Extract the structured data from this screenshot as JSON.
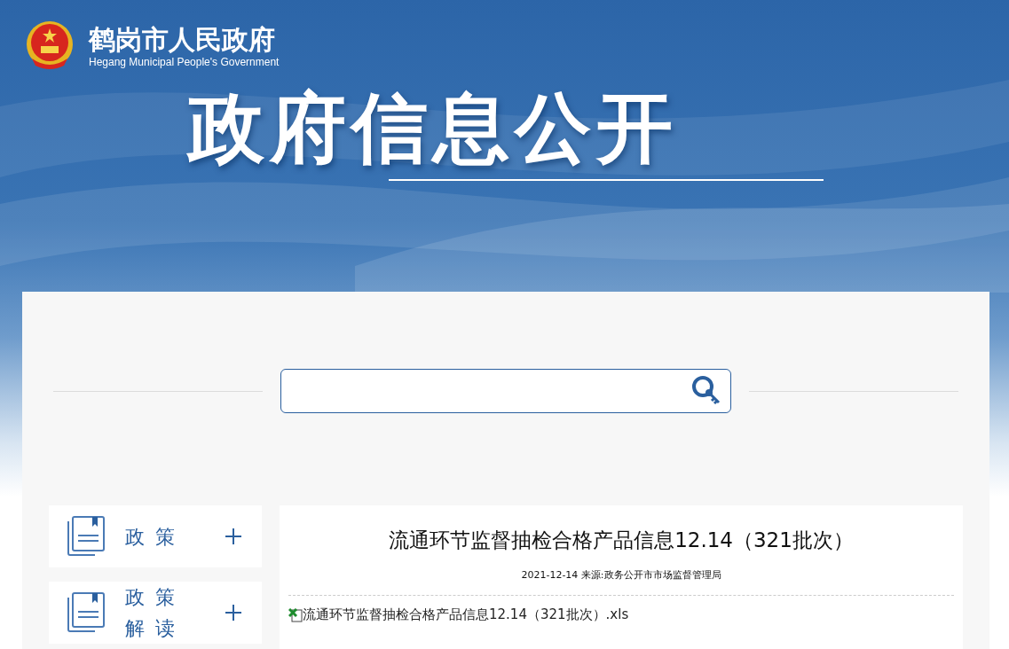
{
  "header": {
    "site_name": "鹤岗市人民政府",
    "site_name_en": "Hegang Municipal People's Government",
    "banner_title": "政府信息公开"
  },
  "sidebar": {
    "items": [
      {
        "label": "政策",
        "expanded": false
      },
      {
        "label": "政策解读",
        "expanded": false
      }
    ]
  },
  "article": {
    "title": "流通环节监督抽检合格产品信息12.14（321批次）",
    "meta": "2021-12-14 来源:政务公开市市场监督管理局",
    "attachment": "流通环节监督抽检合格产品信息12.14（321批次）.xls"
  }
}
